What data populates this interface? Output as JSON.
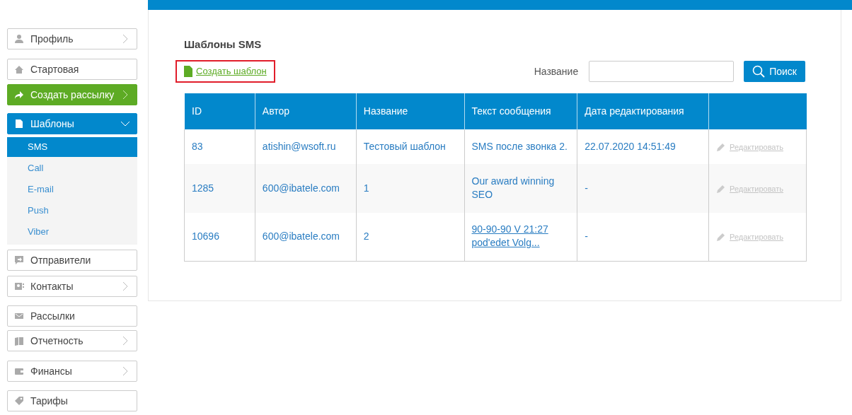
{
  "sidebar": {
    "items": [
      {
        "label": "Профиль",
        "kind": "plain",
        "selected": false,
        "expanded": false
      },
      {
        "label": "Стартовая",
        "kind": "plain",
        "selected": false
      },
      {
        "label": "Создать рассылку",
        "kind": "accent",
        "selected": false,
        "expanded": false
      },
      {
        "label": "Шаблоны",
        "kind": "plain",
        "selected": true,
        "expanded": true,
        "children": [
          {
            "label": "SMS",
            "selected": true
          },
          {
            "label": "Call",
            "selected": false
          },
          {
            "label": "E-mail",
            "selected": false
          },
          {
            "label": "Push",
            "selected": false
          },
          {
            "label": "Viber",
            "selected": false
          }
        ]
      },
      {
        "label": "Отправители",
        "kind": "plain",
        "selected": false
      },
      {
        "label": "Контакты",
        "kind": "plain",
        "selected": false,
        "expanded": false
      },
      {
        "label": "Рассылки",
        "kind": "plain",
        "selected": false
      },
      {
        "label": "Отчетность",
        "kind": "plain",
        "selected": false,
        "expanded": false
      },
      {
        "label": "Финансы",
        "kind": "plain",
        "selected": false,
        "expanded": false
      },
      {
        "label": "Тарифы",
        "kind": "plain",
        "selected": false
      }
    ]
  },
  "page": {
    "title": "Шаблоны SMS",
    "create_link": {
      "label": "Создать шаблон",
      "highlighted": true
    },
    "search": {
      "label": "Название",
      "button": "Поиск"
    }
  },
  "table": {
    "columns": [
      "ID",
      "Автор",
      "Название",
      "Текст сообщения",
      "Дата редактирования"
    ],
    "rows": [
      {
        "cells": [
          "83",
          "atishin@wsoft.ru",
          "Тестовый шаблон",
          "SMS после звонка 2.",
          "22.07.2020 14:51:49"
        ],
        "message_link": false,
        "action": "Редактировать"
      },
      {
        "cells": [
          "1285",
          "600@ibatele.com",
          "1",
          "Our award winning SEO",
          "-"
        ],
        "message_link": false,
        "action": "Редактировать"
      },
      {
        "cells": [
          "10696",
          "600@ibatele.com",
          "2",
          "90-90-90 V 21:27 pod'edet Volg...",
          "-"
        ],
        "message_link": true,
        "action": "Редактировать"
      }
    ]
  }
}
